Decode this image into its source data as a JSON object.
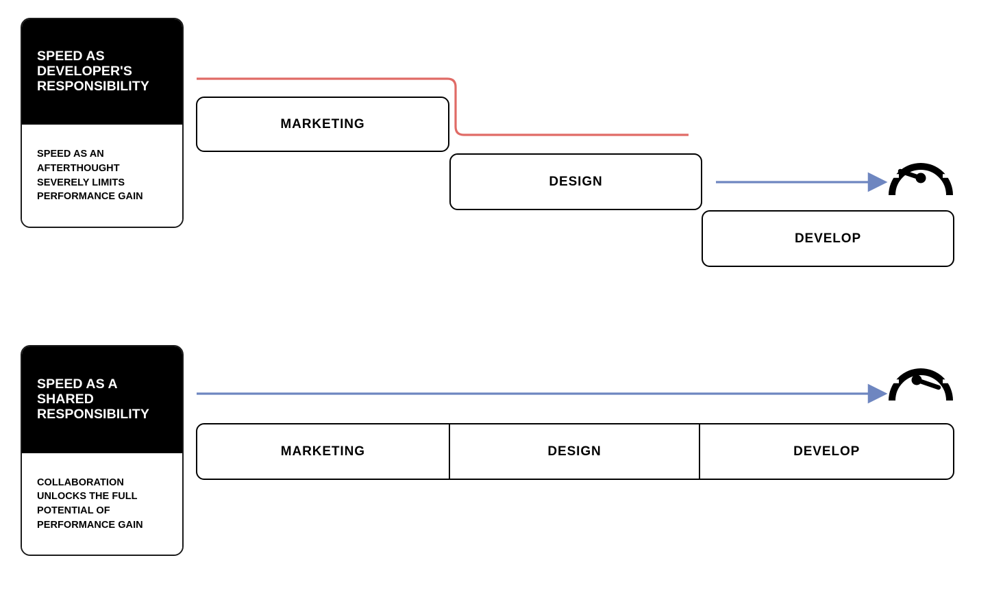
{
  "diagram": {
    "title_semantic": "speed-responsibility-comparison",
    "colors": {
      "red_path": "#E06B66",
      "blue_arrow": "#6E86C0",
      "box_border": "#000000",
      "card_header_bg": "#000000",
      "card_header_text": "#FFFFFF",
      "canvas_bg": "#FFFFFF"
    }
  },
  "scenarios": [
    {
      "id": "developer-responsibility",
      "card": {
        "headline": "SPEED AS\nDEVELOPER'S\nRESPONSIBILITY",
        "subtext": "SPEED AS AN\nAFTERTHOUGHT\nSEVERELY LIMITS\nPERFORMANCE GAIN"
      },
      "stages": [
        {
          "label": "MARKETING"
        },
        {
          "label": "DESIGN"
        },
        {
          "label": "DEVELOP"
        }
      ],
      "gauge": {
        "name": "speedometer-low",
        "needle_direction": "left-down",
        "reading": "low"
      }
    },
    {
      "id": "shared-responsibility",
      "card": {
        "headline": "SPEED AS A\nSHARED\nRESPONSIBILITY",
        "subtext": "COLLABORATION\nUNLOCKS THE FULL\nPOTENTIAL OF\nPERFORMANCE GAIN"
      },
      "stages": [
        {
          "label": "MARKETING"
        },
        {
          "label": "DESIGN"
        },
        {
          "label": "DEVELOP"
        }
      ],
      "gauge": {
        "name": "speedometer-high",
        "needle_direction": "right-down",
        "reading": "high"
      }
    }
  ]
}
